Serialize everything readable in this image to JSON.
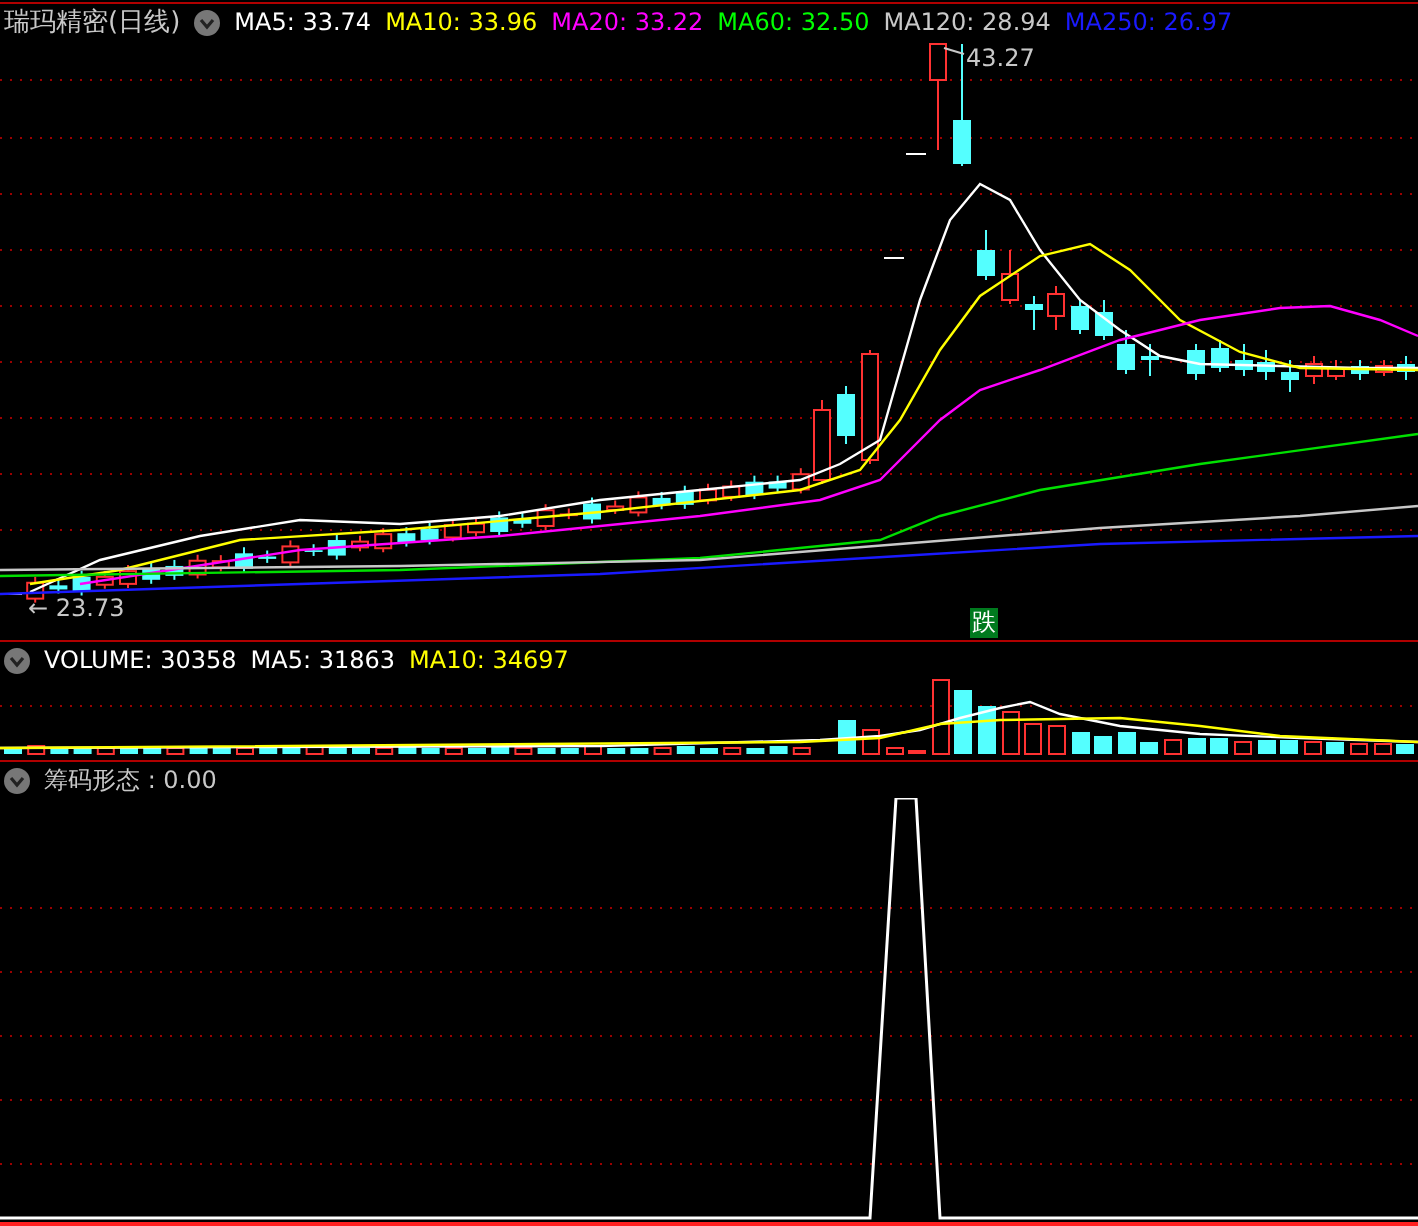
{
  "main_panel": {
    "title": "瑞玛精密(日线)",
    "legend": [
      {
        "text": "MA5: 33.74",
        "color": "#ffffff"
      },
      {
        "text": "MA10: 33.96",
        "color": "#ffff00"
      },
      {
        "text": "MA20: 33.22",
        "color": "#ff00ff"
      },
      {
        "text": "MA60: 32.50",
        "color": "#00ff00"
      },
      {
        "text": "MA120: 28.94",
        "color": "#c8c8c8"
      },
      {
        "text": "MA250: 26.97",
        "color": "#1a1aff"
      }
    ],
    "high_label": "43.27",
    "low_label": "← 23.73",
    "signal_badge": "跌"
  },
  "volume_panel": {
    "legend": [
      {
        "text": "VOLUME: 30358",
        "color": "#ffffff"
      },
      {
        "text": "MA5: 31863",
        "color": "#ffffff"
      },
      {
        "text": "MA10: 34697",
        "color": "#ffff00"
      }
    ]
  },
  "indicator_panel": {
    "legend": [
      {
        "text": "筹码形态 : 0.00",
        "color": "#c8c8c8"
      }
    ]
  }
}
